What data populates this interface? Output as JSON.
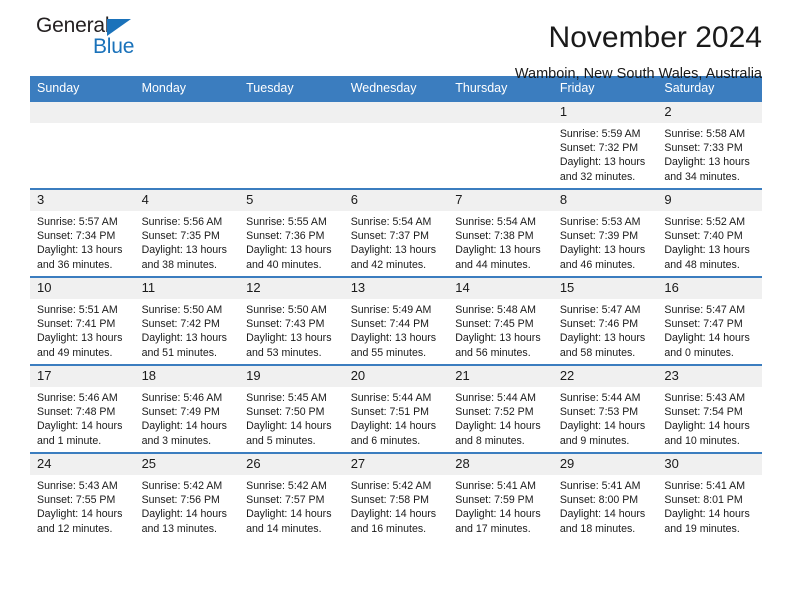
{
  "logo": {
    "word_top": "General",
    "word_bottom": "Blue",
    "accent_color": "#1a72ba"
  },
  "header": {
    "title": "November 2024",
    "subtitle": "Wamboin, New South Wales, Australia",
    "header_bg_color": "#3b7dbf"
  },
  "calendar": {
    "weekday_headers": [
      "Sunday",
      "Monday",
      "Tuesday",
      "Wednesday",
      "Thursday",
      "Friday",
      "Saturday"
    ],
    "weeks": [
      [
        {
          "day": "",
          "lines": []
        },
        {
          "day": "",
          "lines": []
        },
        {
          "day": "",
          "lines": []
        },
        {
          "day": "",
          "lines": []
        },
        {
          "day": "",
          "lines": []
        },
        {
          "day": "1",
          "lines": [
            "Sunrise: 5:59 AM",
            "Sunset: 7:32 PM",
            "Daylight: 13 hours and 32 minutes."
          ]
        },
        {
          "day": "2",
          "lines": [
            "Sunrise: 5:58 AM",
            "Sunset: 7:33 PM",
            "Daylight: 13 hours and 34 minutes."
          ]
        }
      ],
      [
        {
          "day": "3",
          "lines": [
            "Sunrise: 5:57 AM",
            "Sunset: 7:34 PM",
            "Daylight: 13 hours and 36 minutes."
          ]
        },
        {
          "day": "4",
          "lines": [
            "Sunrise: 5:56 AM",
            "Sunset: 7:35 PM",
            "Daylight: 13 hours and 38 minutes."
          ]
        },
        {
          "day": "5",
          "lines": [
            "Sunrise: 5:55 AM",
            "Sunset: 7:36 PM",
            "Daylight: 13 hours and 40 minutes."
          ]
        },
        {
          "day": "6",
          "lines": [
            "Sunrise: 5:54 AM",
            "Sunset: 7:37 PM",
            "Daylight: 13 hours and 42 minutes."
          ]
        },
        {
          "day": "7",
          "lines": [
            "Sunrise: 5:54 AM",
            "Sunset: 7:38 PM",
            "Daylight: 13 hours and 44 minutes."
          ]
        },
        {
          "day": "8",
          "lines": [
            "Sunrise: 5:53 AM",
            "Sunset: 7:39 PM",
            "Daylight: 13 hours and 46 minutes."
          ]
        },
        {
          "day": "9",
          "lines": [
            "Sunrise: 5:52 AM",
            "Sunset: 7:40 PM",
            "Daylight: 13 hours and 48 minutes."
          ]
        }
      ],
      [
        {
          "day": "10",
          "lines": [
            "Sunrise: 5:51 AM",
            "Sunset: 7:41 PM",
            "Daylight: 13 hours and 49 minutes."
          ]
        },
        {
          "day": "11",
          "lines": [
            "Sunrise: 5:50 AM",
            "Sunset: 7:42 PM",
            "Daylight: 13 hours and 51 minutes."
          ]
        },
        {
          "day": "12",
          "lines": [
            "Sunrise: 5:50 AM",
            "Sunset: 7:43 PM",
            "Daylight: 13 hours and 53 minutes."
          ]
        },
        {
          "day": "13",
          "lines": [
            "Sunrise: 5:49 AM",
            "Sunset: 7:44 PM",
            "Daylight: 13 hours and 55 minutes."
          ]
        },
        {
          "day": "14",
          "lines": [
            "Sunrise: 5:48 AM",
            "Sunset: 7:45 PM",
            "Daylight: 13 hours and 56 minutes."
          ]
        },
        {
          "day": "15",
          "lines": [
            "Sunrise: 5:47 AM",
            "Sunset: 7:46 PM",
            "Daylight: 13 hours and 58 minutes."
          ]
        },
        {
          "day": "16",
          "lines": [
            "Sunrise: 5:47 AM",
            "Sunset: 7:47 PM",
            "Daylight: 14 hours and 0 minutes."
          ]
        }
      ],
      [
        {
          "day": "17",
          "lines": [
            "Sunrise: 5:46 AM",
            "Sunset: 7:48 PM",
            "Daylight: 14 hours and 1 minute."
          ]
        },
        {
          "day": "18",
          "lines": [
            "Sunrise: 5:46 AM",
            "Sunset: 7:49 PM",
            "Daylight: 14 hours and 3 minutes."
          ]
        },
        {
          "day": "19",
          "lines": [
            "Sunrise: 5:45 AM",
            "Sunset: 7:50 PM",
            "Daylight: 14 hours and 5 minutes."
          ]
        },
        {
          "day": "20",
          "lines": [
            "Sunrise: 5:44 AM",
            "Sunset: 7:51 PM",
            "Daylight: 14 hours and 6 minutes."
          ]
        },
        {
          "day": "21",
          "lines": [
            "Sunrise: 5:44 AM",
            "Sunset: 7:52 PM",
            "Daylight: 14 hours and 8 minutes."
          ]
        },
        {
          "day": "22",
          "lines": [
            "Sunrise: 5:44 AM",
            "Sunset: 7:53 PM",
            "Daylight: 14 hours and 9 minutes."
          ]
        },
        {
          "day": "23",
          "lines": [
            "Sunrise: 5:43 AM",
            "Sunset: 7:54 PM",
            "Daylight: 14 hours and 10 minutes."
          ]
        }
      ],
      [
        {
          "day": "24",
          "lines": [
            "Sunrise: 5:43 AM",
            "Sunset: 7:55 PM",
            "Daylight: 14 hours and 12 minutes."
          ]
        },
        {
          "day": "25",
          "lines": [
            "Sunrise: 5:42 AM",
            "Sunset: 7:56 PM",
            "Daylight: 14 hours and 13 minutes."
          ]
        },
        {
          "day": "26",
          "lines": [
            "Sunrise: 5:42 AM",
            "Sunset: 7:57 PM",
            "Daylight: 14 hours and 14 minutes."
          ]
        },
        {
          "day": "27",
          "lines": [
            "Sunrise: 5:42 AM",
            "Sunset: 7:58 PM",
            "Daylight: 14 hours and 16 minutes."
          ]
        },
        {
          "day": "28",
          "lines": [
            "Sunrise: 5:41 AM",
            "Sunset: 7:59 PM",
            "Daylight: 14 hours and 17 minutes."
          ]
        },
        {
          "day": "29",
          "lines": [
            "Sunrise: 5:41 AM",
            "Sunset: 8:00 PM",
            "Daylight: 14 hours and 18 minutes."
          ]
        },
        {
          "day": "30",
          "lines": [
            "Sunrise: 5:41 AM",
            "Sunset: 8:01 PM",
            "Daylight: 14 hours and 19 minutes."
          ]
        }
      ]
    ]
  }
}
